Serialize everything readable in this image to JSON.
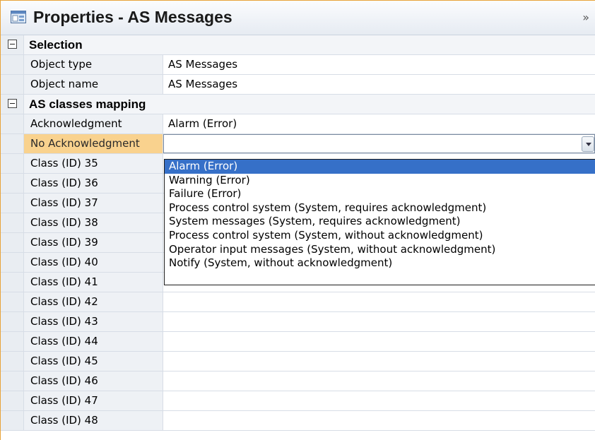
{
  "window": {
    "title": "Properties - AS Messages",
    "collapse_label": "»"
  },
  "sections": [
    {
      "label": "Selection",
      "rows": [
        {
          "name": "Object type",
          "value": "AS Messages"
        },
        {
          "name": "Object name",
          "value": "AS Messages"
        }
      ]
    },
    {
      "label": "AS classes mapping",
      "rows": [
        {
          "name": "Acknowledgment",
          "value": "Alarm (Error)"
        },
        {
          "name": "No Acknowledgment",
          "value": "",
          "selected": true,
          "editing": true
        },
        {
          "name": "Class (ID) 35",
          "value": ""
        },
        {
          "name": "Class (ID) 36",
          "value": ""
        },
        {
          "name": "Class (ID) 37",
          "value": ""
        },
        {
          "name": "Class (ID) 38",
          "value": ""
        },
        {
          "name": "Class (ID) 39",
          "value": ""
        },
        {
          "name": "Class (ID) 40",
          "value": ""
        },
        {
          "name": "Class (ID) 41",
          "value": ""
        },
        {
          "name": "Class (ID) 42",
          "value": ""
        },
        {
          "name": "Class (ID) 43",
          "value": ""
        },
        {
          "name": "Class (ID) 44",
          "value": ""
        },
        {
          "name": "Class (ID) 45",
          "value": ""
        },
        {
          "name": "Class (ID) 46",
          "value": ""
        },
        {
          "name": "Class (ID) 47",
          "value": ""
        },
        {
          "name": "Class (ID) 48",
          "value": ""
        }
      ]
    }
  ],
  "dropdown": {
    "options": [
      "Alarm (Error)",
      "Warning (Error)",
      "Failure (Error)",
      "Process control system (System, requires acknowledgment)",
      "System messages (System, requires acknowledgment)",
      "Process control system (System, without acknowledgment)",
      "Operator input messages (System, without acknowledgment)",
      "Notify (System, without acknowledgment)"
    ],
    "selected_index": 0
  },
  "colors": {
    "panel_border": "#e8a33a",
    "selected_row_name": "#f9d28e",
    "dropdown_highlight": "#3670c8"
  },
  "icons": {
    "title_icon": "properties-window-icon",
    "expand_toggle": "minus-box-icon",
    "dropdown_arrow": "chevron-down-icon"
  }
}
